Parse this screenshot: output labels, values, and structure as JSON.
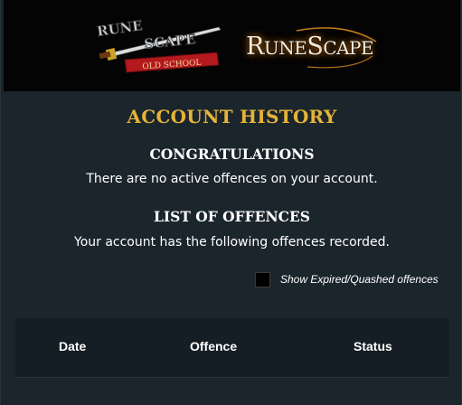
{
  "header": {
    "osrs_logo": {
      "word_top": "RUNE",
      "word_bottom": "SCAPE",
      "subtitle": "OLD SCHOOL",
      "icon": "osrs-sword-logo-icon"
    },
    "rs_logo": {
      "text_big_r": "R",
      "text_une": "UNE",
      "text_big_s": "S",
      "text_cape": "CAPE",
      "icon": "runescape-logo-icon"
    }
  },
  "page": {
    "title": "ACCOUNT HISTORY",
    "congrats_heading": "CONGRATULATIONS",
    "congrats_text": "There are no active offences on your account.",
    "list_heading": "LIST OF OFFENCES",
    "list_text": "Your account has the following offences recorded."
  },
  "toggle": {
    "label": "Show Expired/Quashed offences",
    "checked": false
  },
  "table": {
    "columns": [
      "Date",
      "Offence",
      "Status"
    ],
    "rows": []
  },
  "colors": {
    "background": "#1b252c",
    "banner": "#040404",
    "title_gold": "#e5b338",
    "table_bg": "#151e24"
  }
}
